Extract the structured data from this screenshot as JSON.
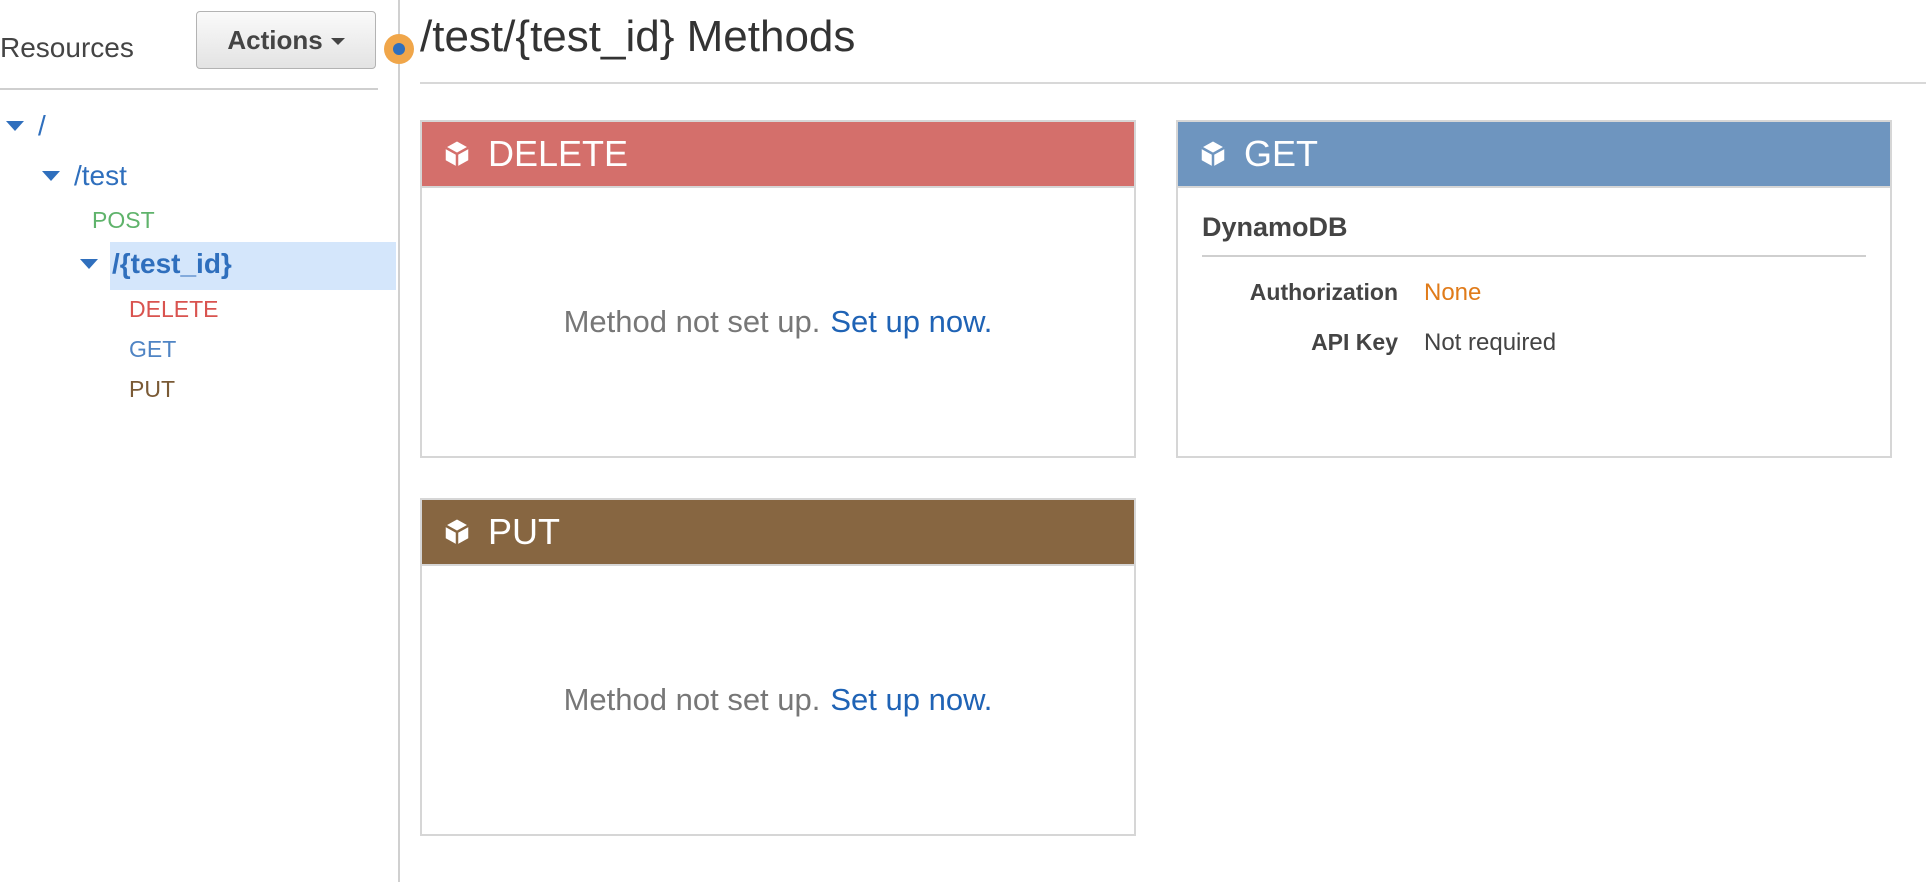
{
  "sidebar": {
    "title": "Resources",
    "actions_label": "Actions",
    "tree": {
      "root": "/",
      "test": "/test",
      "test_post": "POST",
      "test_id": "/{test_id}",
      "test_id_methods": [
        "DELETE",
        "GET",
        "PUT"
      ]
    }
  },
  "main": {
    "title": "/test/{test_id} Methods",
    "cards": {
      "delete": {
        "method": "DELETE",
        "empty_text": "Method not set up.",
        "setup_link": "Set up now."
      },
      "get": {
        "method": "GET",
        "integration": "DynamoDB",
        "auth_label": "Authorization",
        "auth_value": "None",
        "apikey_label": "API Key",
        "apikey_value": "Not required"
      },
      "put": {
        "method": "PUT",
        "empty_text": "Method not set up.",
        "setup_link": "Set up now."
      }
    }
  },
  "colors": {
    "delete": "#d46f6b",
    "get": "#6e95bf",
    "put": "#876641",
    "post": "#5fb36b",
    "link": "#2f6fbd",
    "auth_none": "#e07b1a",
    "selected_bg": "#d4e6fb"
  },
  "icons": [
    "cube-icon",
    "caret-down-icon",
    "tree-expand-icon",
    "drag-handle-icon"
  ]
}
